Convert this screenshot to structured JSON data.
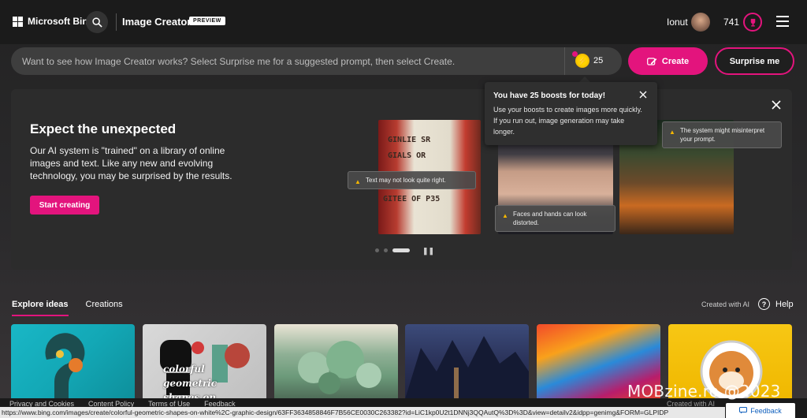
{
  "header": {
    "brand": "Microsoft Bing",
    "product": "Image Creator",
    "badge": "PREVIEW",
    "user_name": "Ionut",
    "points": "741"
  },
  "prompt": {
    "placeholder": "Want to see how Image Creator works? Select Surprise me for a suggested prompt, then select Create.",
    "boosts": "25",
    "create_label": "Create",
    "surprise_label": "Surprise me"
  },
  "popup": {
    "title": "You have 25 boosts for today!",
    "text": "Use your boosts to create images more quickly. If you run out, image generation may take longer."
  },
  "banner": {
    "title": "Expect the unexpected",
    "text": "Our AI system is \"trained\" on a library of online images and text. Like any new and evolving technology, you may be surprised by the results.",
    "start_label": "Start creating",
    "pump_text": [
      "GINLIE SR",
      "GIALS OR",
      "GITEE OF P35"
    ],
    "tips": {
      "text": "Text may not look quite right.",
      "faces": "Faces and hands can look distorted.",
      "prompt": "The system might misinterpret your prompt."
    }
  },
  "tabs": {
    "explore": "Explore ideas",
    "creations": "Creations",
    "created_with_ai": "Created with AI",
    "help": "Help"
  },
  "gallery": {
    "card2_text": "colorful geometric shapes on white."
  },
  "footer": {
    "links": [
      "Privacy and Cookies",
      "Content Policy",
      "Terms of Use",
      "Feedback"
    ],
    "right_text": "Created with AI",
    "status_url": "https://www.bing.com/images/create/colorful-geometric-shapes-on-white%2C-graphic-design/63FF3634858846F7B56CE0030C263382?id=LiC1kp0U2t1DNNj3QQAutQ%3D%3D&view=detailv2&idpp=genimg&FORM=GLPIDP",
    "feedback": "Feedback"
  },
  "watermark": "MOBzine.ro @2023",
  "colors": {
    "accent": "#e3147d",
    "background": "#232323",
    "boost": "#ffd400"
  },
  "icons": [
    "search-icon",
    "close-icon",
    "warning-icon",
    "hamburger-menu-icon",
    "trophy-icon",
    "help-icon",
    "create-icon",
    "pause-icon"
  ]
}
